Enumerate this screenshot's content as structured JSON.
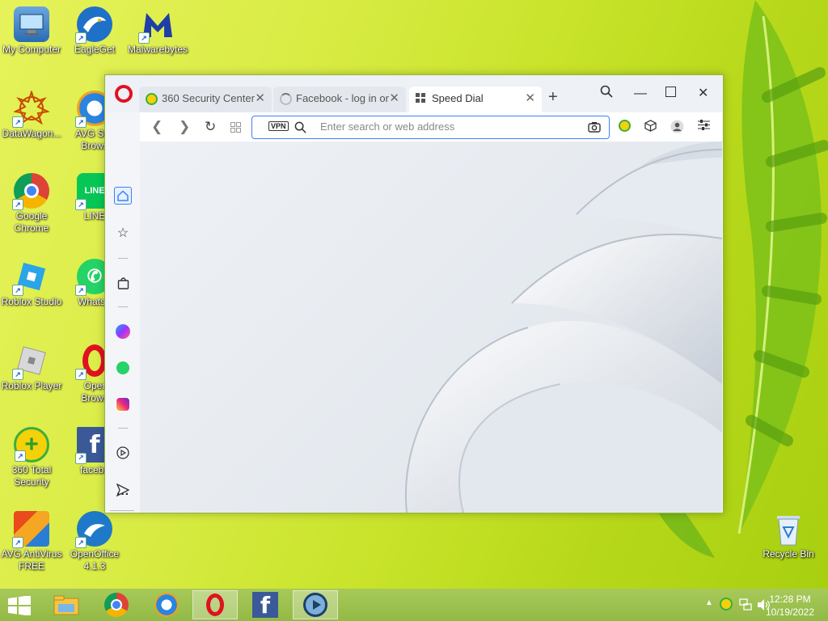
{
  "desktop": {
    "icons": [
      {
        "label": "My Computer"
      },
      {
        "label": "EagleGet"
      },
      {
        "label": "Malwarebytes"
      },
      {
        "label": "DataWagon..."
      },
      {
        "label": "AVG Sec\nBrows"
      },
      {
        "label": "Google Chrome"
      },
      {
        "label": "LINE"
      },
      {
        "label": "Roblox Studio"
      },
      {
        "label": "WhatsA"
      },
      {
        "label": "Roblox Player"
      },
      {
        "label": "Oper\nBrows"
      },
      {
        "label": "360 Total Security"
      },
      {
        "label": "facebo"
      },
      {
        "label": "AVG AntiVirus FREE"
      },
      {
        "label": "OpenOffice 4.1.3"
      },
      {
        "label": "Recycle Bin"
      }
    ]
  },
  "browser": {
    "tabs": [
      {
        "title": "360 Security Center",
        "state": "inactive"
      },
      {
        "title": "Facebook - log in or",
        "state": "inactive"
      },
      {
        "title": "Speed Dial",
        "state": "active"
      }
    ],
    "address": {
      "vpn_label": "VPN",
      "placeholder": "Enter search or web address",
      "value": ""
    }
  },
  "taskbar": {
    "time": "12:28 PM",
    "date": "10/19/2022"
  },
  "colors": {
    "opera_red": "#e0121f",
    "accent_blue": "#3b82f6",
    "taskbar_green": "#9bbf4a"
  }
}
